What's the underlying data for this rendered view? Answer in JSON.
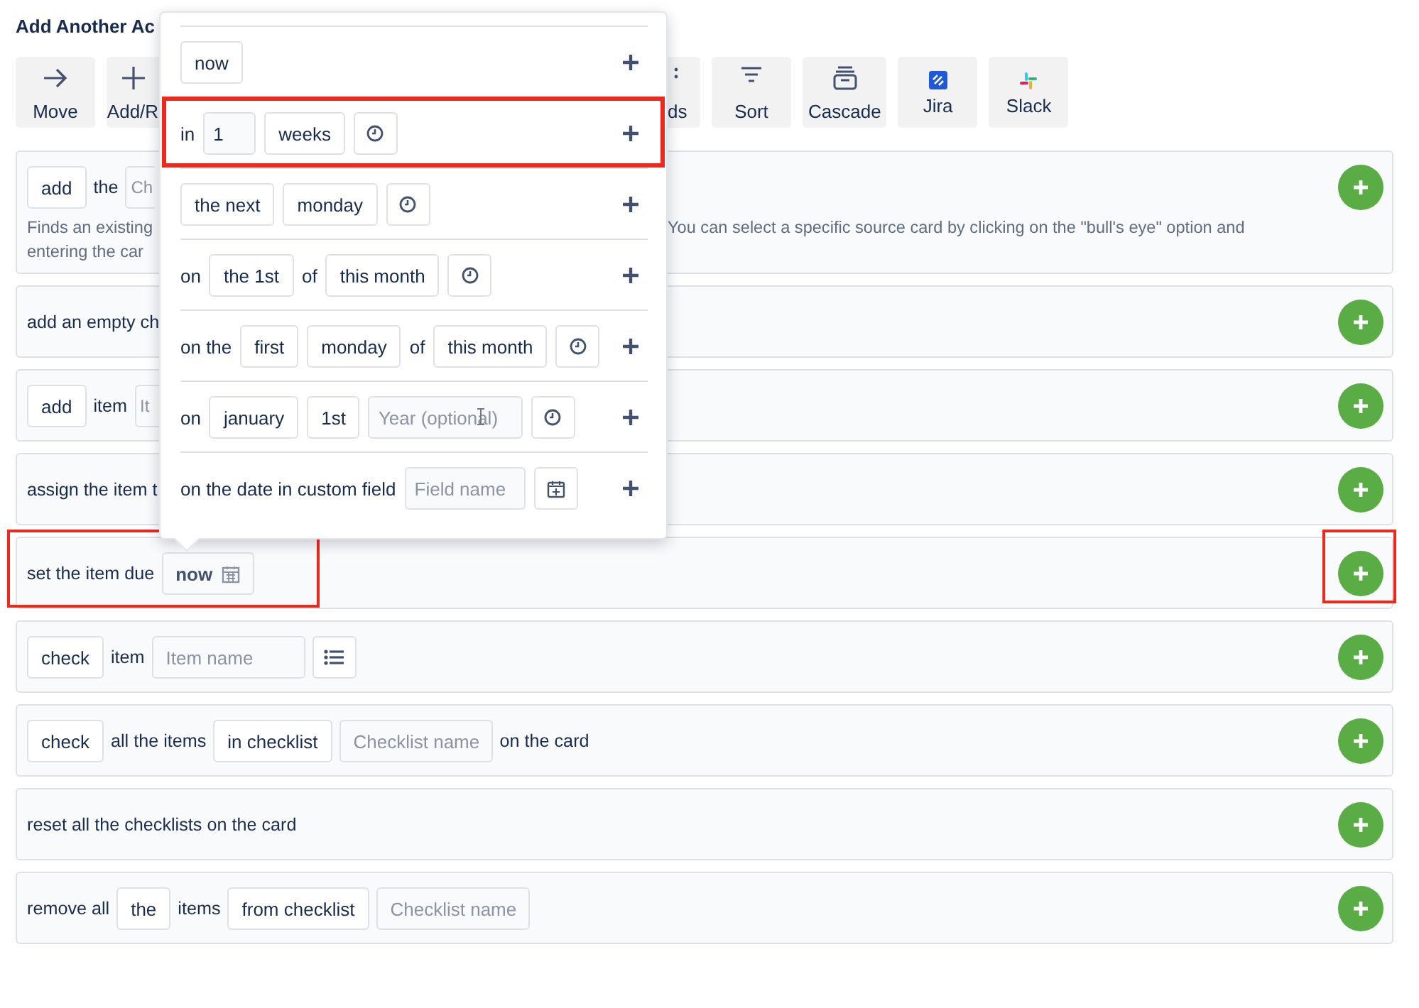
{
  "heading": "Add Another Ac",
  "toolbar": [
    {
      "kind": "arrow",
      "label": "Move"
    },
    {
      "kind": "plus",
      "label": "Add/R"
    },
    {
      "kind": "dots",
      "label": "ds"
    },
    {
      "kind": "filter",
      "label": "Sort"
    },
    {
      "kind": "tray",
      "label": "Cascade"
    },
    {
      "kind": "square-logo",
      "label": "Jira"
    },
    {
      "kind": "hash-logo",
      "label": "Slack"
    }
  ],
  "cards": [
    {
      "parts": [
        {
          "kind": "chip",
          "text": "add"
        },
        {
          "kind": "text",
          "text": "the"
        },
        {
          "kind": "field",
          "placeholder": "Ch"
        }
      ],
      "description_left": [
        "Finds an existing",
        "entering the car"
      ],
      "description_right": "You can select a specific source card by clicking on the \"bull's eye\" option and",
      "highlighted_rule": false,
      "highlighted_add": false
    },
    {
      "parts": [
        {
          "kind": "text",
          "text": "add an empty ch"
        }
      ],
      "highlighted_rule": false,
      "highlighted_add": false
    },
    {
      "parts": [
        {
          "kind": "chip",
          "text": "add"
        },
        {
          "kind": "text",
          "text": "item"
        },
        {
          "kind": "field",
          "placeholder": "It"
        }
      ],
      "highlighted_rule": false,
      "highlighted_add": false
    },
    {
      "parts": [
        {
          "kind": "text",
          "text": "assign the item t"
        }
      ],
      "highlighted_rule": false,
      "highlighted_add": false
    },
    {
      "parts": [
        {
          "kind": "text",
          "text": "set the item due"
        },
        {
          "kind": "date-chip",
          "text": "now"
        }
      ],
      "highlighted_rule": true,
      "highlighted_add": true
    },
    {
      "parts": [
        {
          "kind": "chip",
          "text": "check"
        },
        {
          "kind": "text",
          "text": "item"
        },
        {
          "kind": "field",
          "placeholder": "Item name"
        },
        {
          "kind": "list-button"
        }
      ],
      "highlighted_rule": false,
      "highlighted_add": false
    },
    {
      "parts": [
        {
          "kind": "chip",
          "text": "check"
        },
        {
          "kind": "text",
          "text": "all the items"
        },
        {
          "kind": "chip",
          "text": "in checklist"
        },
        {
          "kind": "field",
          "placeholder": "Checklist name"
        },
        {
          "kind": "text",
          "text": "on the card"
        }
      ],
      "highlighted_rule": false,
      "highlighted_add": false
    },
    {
      "parts": [
        {
          "kind": "text",
          "text": "reset all the checklists on the card"
        }
      ],
      "highlighted_rule": false,
      "highlighted_add": false
    },
    {
      "parts": [
        {
          "kind": "text",
          "text": "remove all"
        },
        {
          "kind": "chip",
          "text": "the"
        },
        {
          "kind": "text",
          "text": "items"
        },
        {
          "kind": "chip",
          "text": "from checklist"
        },
        {
          "kind": "field",
          "placeholder": "Checklist name"
        }
      ],
      "highlighted_rule": false,
      "highlighted_add": false
    }
  ],
  "date_options": [
    {
      "parts": [
        {
          "kind": "chip",
          "text": "now"
        }
      ],
      "highlighted": false
    },
    {
      "parts": [
        {
          "kind": "text",
          "text": "in"
        },
        {
          "kind": "field",
          "value": "1"
        },
        {
          "kind": "chip",
          "text": "weeks"
        },
        {
          "kind": "clock-button"
        }
      ],
      "highlighted": true
    },
    {
      "parts": [
        {
          "kind": "chip",
          "text": "the next"
        },
        {
          "kind": "chip",
          "text": "monday"
        },
        {
          "kind": "clock-button"
        }
      ],
      "highlighted": false
    },
    {
      "parts": [
        {
          "kind": "text",
          "text": "on"
        },
        {
          "kind": "chip",
          "text": "the 1st"
        },
        {
          "kind": "text",
          "text": "of"
        },
        {
          "kind": "chip",
          "text": "this month"
        },
        {
          "kind": "clock-button"
        }
      ],
      "highlighted": false
    },
    {
      "parts": [
        {
          "kind": "text",
          "text": "on the"
        },
        {
          "kind": "chip",
          "text": "first"
        },
        {
          "kind": "chip",
          "text": "monday"
        },
        {
          "kind": "text",
          "text": "of"
        },
        {
          "kind": "chip",
          "text": "this month"
        },
        {
          "kind": "clock-button"
        }
      ],
      "highlighted": false
    },
    {
      "parts": [
        {
          "kind": "text",
          "text": "on"
        },
        {
          "kind": "chip",
          "text": "january"
        },
        {
          "kind": "chip",
          "text": "1st"
        },
        {
          "kind": "field",
          "placeholder": "Year (optional)",
          "hovered": true
        },
        {
          "kind": "clock-button"
        }
      ],
      "highlighted": false
    },
    {
      "parts": [
        {
          "kind": "text",
          "text": "on the date in custom field"
        },
        {
          "kind": "field",
          "placeholder": "Field name"
        },
        {
          "kind": "calendar-button"
        }
      ],
      "highlighted": false
    }
  ]
}
